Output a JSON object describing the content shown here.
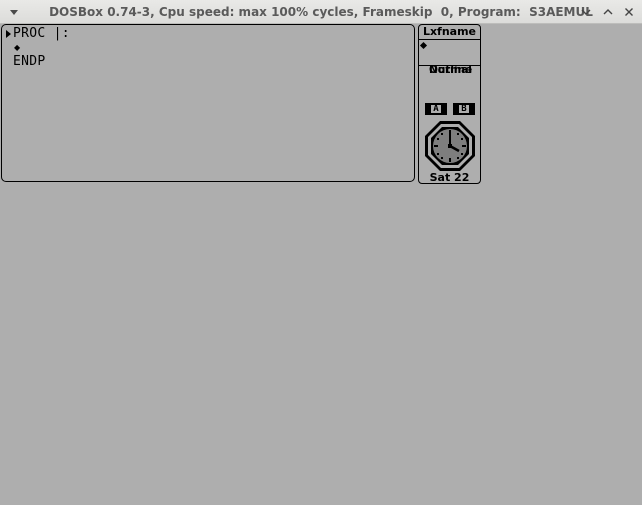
{
  "window": {
    "title": "DOSBox 0.74-3, Cpu speed: max 100% cycles, Frameskip  0, Program:  S3AEMUL",
    "menu_icon": "chevron-down-icon",
    "minimize_icon": "minimize-icon",
    "maximize_icon": "maximize-icon",
    "close_icon": "close-icon"
  },
  "editor": {
    "lines": [
      {
        "text": "PROC |:"
      },
      {
        "text": ""
      },
      {
        "text": "ENDP"
      }
    ],
    "line_marker_icon": "arrow-right-icon",
    "blank_line_marker_icon": "diamond-icon"
  },
  "side_panel": {
    "title": "Lxfname",
    "options": [
      {
        "label": "Normal",
        "selected": true
      },
      {
        "label": "Outline",
        "selected": false
      }
    ],
    "drives": [
      "A",
      "B"
    ],
    "clock": {
      "icon": "clock-icon",
      "hour": 4,
      "minute": 0
    },
    "date": "Sat 22"
  },
  "colors": {
    "background": "#aeaeae",
    "foreground": "#000000",
    "titlebar": "#e0e0de",
    "clock_face": "#7e7e7e"
  }
}
